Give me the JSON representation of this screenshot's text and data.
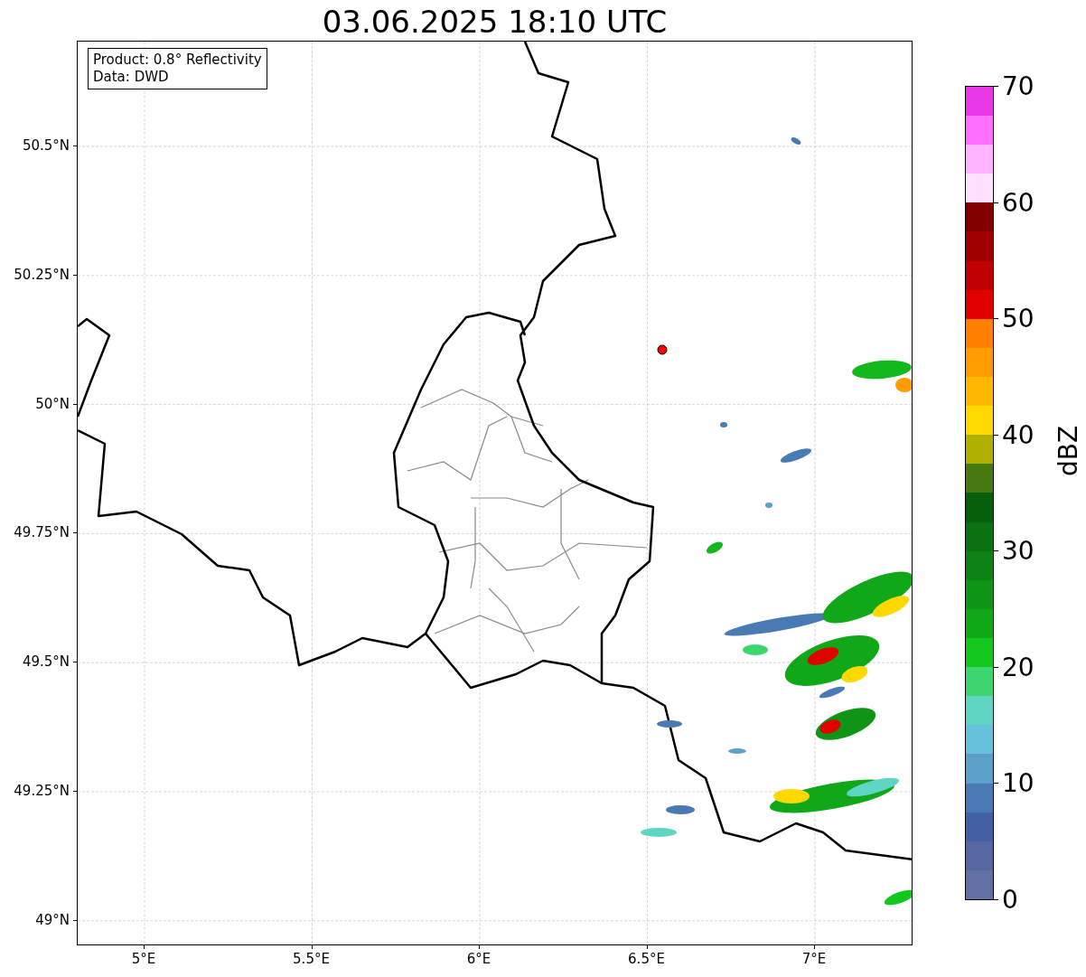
{
  "title": "03.06.2025 18:10 UTC",
  "info_box": {
    "lines": [
      "Product: 0.8° Reflectivity",
      "Data: DWD"
    ]
  },
  "y_ticks": [
    "50.5°N",
    "50.25°N",
    "50°N",
    "49.75°N",
    "49.5°N",
    "49.25°N",
    "49°N"
  ],
  "x_ticks": [
    "5°E",
    "5.5°E",
    "6°E",
    "6.5°E",
    "7°E"
  ],
  "colorbar": {
    "label": "dBZ",
    "ticks": [
      "70",
      "60",
      "50",
      "40",
      "30",
      "20",
      "10",
      "0"
    ],
    "bands": [
      {
        "color": "#6370a6"
      },
      {
        "color": "#5566a0"
      },
      {
        "color": "#4360a3"
      },
      {
        "color": "#4a7ab3"
      },
      {
        "color": "#5aa0c8"
      },
      {
        "color": "#66c2dc"
      },
      {
        "color": "#5fd6c4"
      },
      {
        "color": "#3dd66e"
      },
      {
        "color": "#12c81e"
      },
      {
        "color": "#10a818"
      },
      {
        "color": "#0e9516"
      },
      {
        "color": "#0c8314"
      },
      {
        "color": "#0a730f"
      },
      {
        "color": "#065f0a"
      },
      {
        "color": "#467a10"
      },
      {
        "color": "#b0b000"
      },
      {
        "color": "#ffd800"
      },
      {
        "color": "#ffb800"
      },
      {
        "color": "#ff9c00"
      },
      {
        "color": "#ff7f00"
      },
      {
        "color": "#e00000"
      },
      {
        "color": "#c00000"
      },
      {
        "color": "#a00000"
      },
      {
        "color": "#800000"
      },
      {
        "color": "#ffe0ff"
      },
      {
        "color": "#ffb2ff"
      },
      {
        "color": "#ff6eff"
      },
      {
        "color": "#e838e8"
      }
    ]
  }
}
